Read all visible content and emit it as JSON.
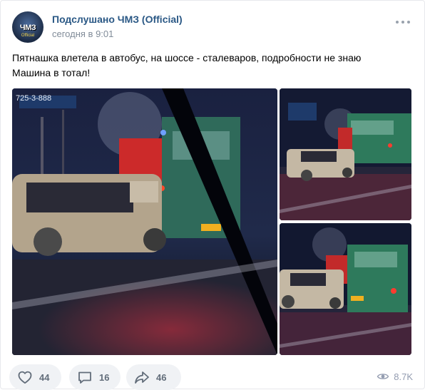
{
  "post": {
    "author": "Подслушано ЧМЗ (Official)",
    "time": "сегодня в 9:01",
    "avatar_text": "ЧМЗ",
    "avatar_subtext": "Official",
    "text_lines": [
      "Пятнашка влетела в автобус, на шоссе - сталеваров, подробности не знаю",
      "Машина в тотал!"
    ],
    "photos": [
      {
        "icon": "photo-car-crash-main",
        "sign_text": "725-3-888"
      },
      {
        "icon": "photo-car-crash-2"
      },
      {
        "icon": "photo-car-crash-3"
      }
    ]
  },
  "actions": {
    "likes": "44",
    "comments": "16",
    "shares": "46",
    "views": "8.7K"
  },
  "colors": {
    "author": "#2a5885",
    "muted": "#818c99",
    "button_bg": "#f0f2f5",
    "icon": "#626d7a"
  }
}
